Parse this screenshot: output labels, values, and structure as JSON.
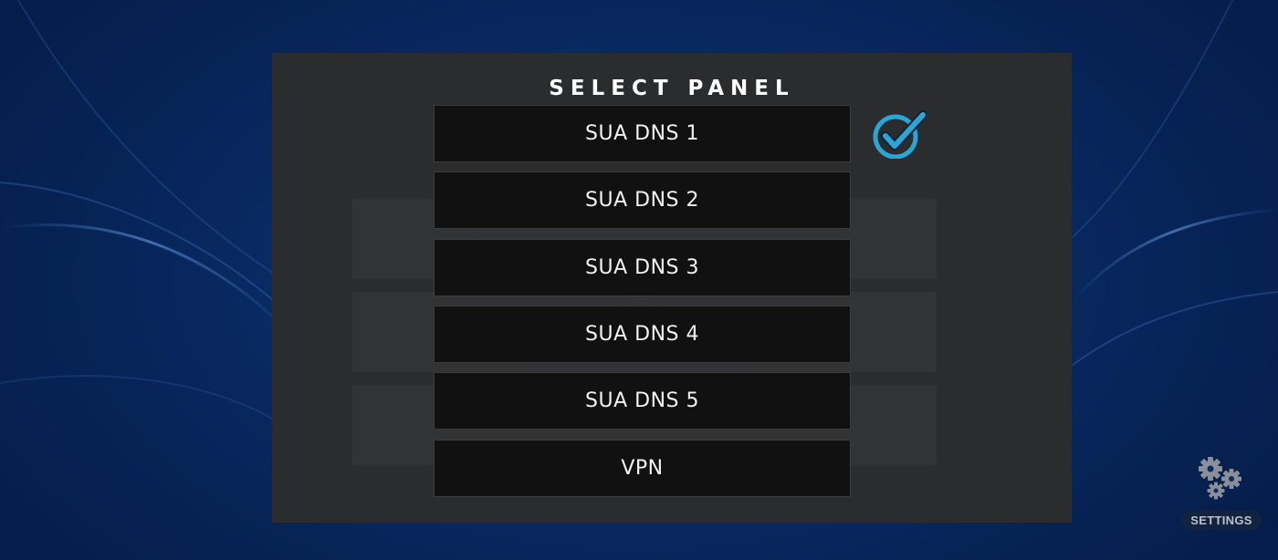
{
  "dialog": {
    "title": "SELECT PANEL",
    "options": [
      {
        "label": "SUA DNS 1",
        "selected": true
      },
      {
        "label": "SUA DNS 2",
        "selected": false
      },
      {
        "label": "SUA DNS 3",
        "selected": false
      },
      {
        "label": "SUA DNS 4",
        "selected": false
      },
      {
        "label": "SUA DNS 5",
        "selected": false
      },
      {
        "label": "VPN",
        "selected": false
      }
    ],
    "selected_icon": "checkmark-circle-icon"
  },
  "settings": {
    "label": "SETTINGS",
    "icon": "gears-icon"
  },
  "colors": {
    "accent": "#29a6d6",
    "background": "#0b2a63",
    "dialog": "#2c2c2c",
    "button": "#111111"
  }
}
